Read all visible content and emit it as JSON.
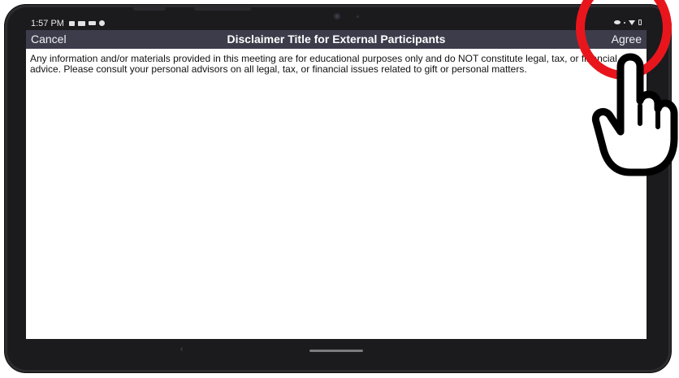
{
  "status_bar": {
    "time": "1:57 PM"
  },
  "app_bar": {
    "cancel_label": "Cancel",
    "title": "Disclaimer Title for External Participants",
    "agree_label": "Agree"
  },
  "content": {
    "disclaimer_text": "Any information and/or materials provided in this meeting are for educational purposes only and do NOT constitute legal, tax, or financial advice. Please consult your personal advisors on all legal, tax, or financial issues related to gift or personal matters."
  },
  "colors": {
    "app_bar_background": "#3c3c4b",
    "highlight_ring": "#e8161c",
    "device_frame": "#1b1b1e"
  },
  "icons": {
    "status_left": [
      "message-icon",
      "image-icon",
      "video-icon",
      "app-circle-icon"
    ],
    "status_right": [
      "eye-icon",
      "wifi-icon",
      "battery-icon"
    ],
    "navigation": [
      "back-icon",
      "home-handle"
    ]
  }
}
